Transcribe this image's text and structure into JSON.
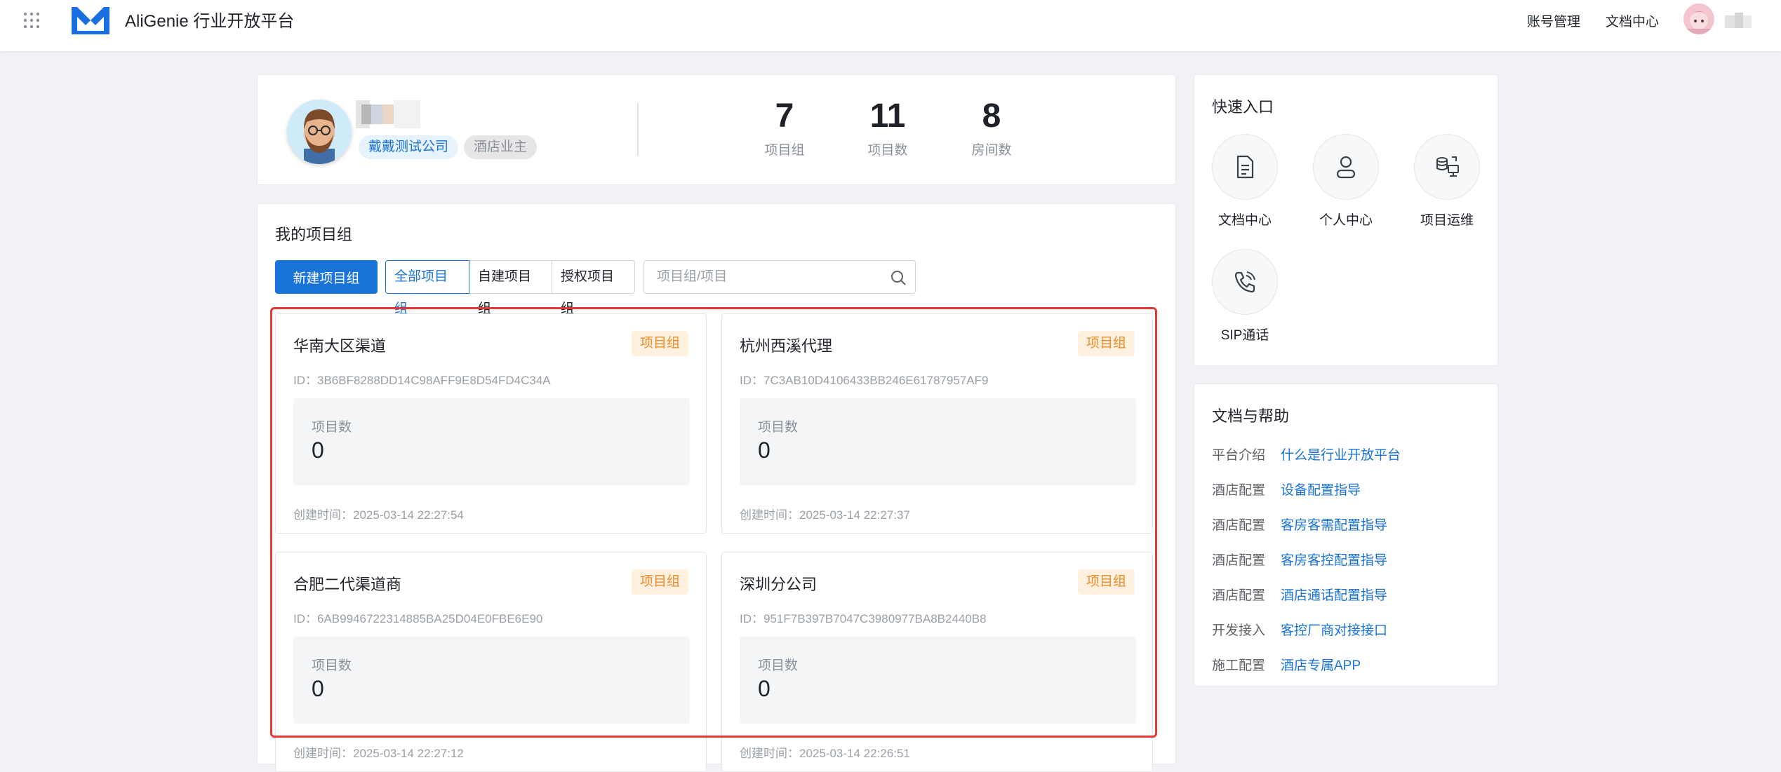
{
  "header": {
    "app_title": "AliGenie 行业开放平台",
    "links": [
      "账号管理",
      "文档中心"
    ]
  },
  "profile": {
    "company_tag": "戴戴测试公司",
    "role_tag": "酒店业主",
    "stats": [
      {
        "value": "7",
        "label": "项目组"
      },
      {
        "value": "11",
        "label": "项目数"
      },
      {
        "value": "8",
        "label": "房间数"
      }
    ]
  },
  "groups": {
    "title": "我的项目组",
    "new_button": "新建项目组",
    "filters": [
      "全部项目组",
      "自建项目组",
      "授权项目组"
    ],
    "active_filter": "全部项目组",
    "search_placeholder": "项目组/项目",
    "items": [
      {
        "name": "华南大区渠道",
        "badge": "项目组",
        "id": "ID：3B6BF8288DD14C98AFF9E8D54FD4C34A",
        "count_label": "项目数",
        "count": "0",
        "created": "创建时间：2025-03-14 22:27:54"
      },
      {
        "name": "杭州西溪代理",
        "badge": "项目组",
        "id": "ID：7C3AB10D4106433BB246E61787957AF9",
        "count_label": "项目数",
        "count": "0",
        "created": "创建时间：2025-03-14 22:27:37"
      },
      {
        "name": "合肥二代渠道商",
        "badge": "项目组",
        "id": "ID：6AB9946722314885BA25D04E0FBE6E90",
        "count_label": "项目数",
        "count": "0",
        "created": "创建时间：2025-03-14 22:27:12"
      },
      {
        "name": "深圳分公司",
        "badge": "项目组",
        "id": "ID：951F7B397B7047C3980977BA8B2440B8",
        "count_label": "项目数",
        "count": "0",
        "created": "创建时间：2025-03-14 22:26:51"
      }
    ]
  },
  "quick_entry": {
    "title": "快速入口",
    "items": [
      {
        "label": "文档中心",
        "icon": "document-icon"
      },
      {
        "label": "个人中心",
        "icon": "user-icon"
      },
      {
        "label": "项目运维",
        "icon": "ops-icon"
      },
      {
        "label": "SIP通话",
        "icon": "phone-icon"
      }
    ]
  },
  "help": {
    "title": "文档与帮助",
    "rows": [
      {
        "category": "平台介绍",
        "link": "什么是行业开放平台"
      },
      {
        "category": "酒店配置",
        "link": "设备配置指导"
      },
      {
        "category": "酒店配置",
        "link": "客房客需配置指导"
      },
      {
        "category": "酒店配置",
        "link": "客房客控配置指导"
      },
      {
        "category": "酒店配置",
        "link": "酒店通话配置指导"
      },
      {
        "category": "开发接入",
        "link": "客控厂商对接接口"
      },
      {
        "category": "施工配置",
        "link": "酒店专属APP"
      }
    ]
  },
  "colors": {
    "primary": "#1a73d9",
    "badge_orange": "#f08a24",
    "highlight_red": "#e53935"
  }
}
